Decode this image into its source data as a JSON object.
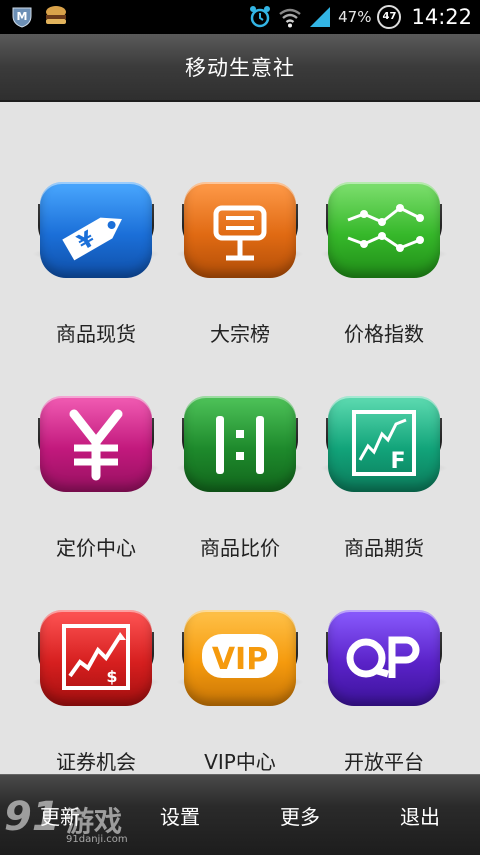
{
  "status_bar": {
    "battery_text": "47%",
    "badge_value": "47",
    "time": "14:22"
  },
  "header": {
    "title": "移动生意社"
  },
  "grid": [
    {
      "label": "商品现货",
      "icon": "price-tag-icon",
      "color": "#1b6fd8"
    },
    {
      "label": "大宗榜",
      "icon": "billboard-icon",
      "color": "#e06a13"
    },
    {
      "label": "价格指数",
      "icon": "line-chart-icon",
      "color": "#36b82a"
    },
    {
      "label": "定价中心",
      "icon": "yuan-icon",
      "color": "#c2197d"
    },
    {
      "label": "商品比价",
      "icon": "ratio-icon",
      "color": "#1e8a2c"
    },
    {
      "label": "商品期货",
      "icon": "futures-chart-icon",
      "color": "#12a47a"
    },
    {
      "label": "证券机会",
      "icon": "stock-chart-icon",
      "color": "#d61f1f"
    },
    {
      "label": "VIP中心",
      "icon": "vip-icon",
      "color": "#f59a0d"
    },
    {
      "label": "开放平台",
      "icon": "op-icon",
      "color": "#5a22c8"
    }
  ],
  "bottom_bar": {
    "items": [
      {
        "label": "更新"
      },
      {
        "label": "设置"
      },
      {
        "label": "更多"
      },
      {
        "label": "退出"
      }
    ]
  },
  "watermark": {
    "brand": "游戏",
    "number": "91",
    "url": "91danji.com"
  }
}
